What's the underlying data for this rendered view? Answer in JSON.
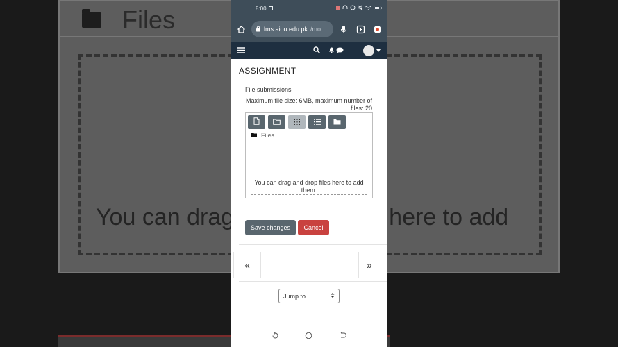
{
  "background": {
    "files_label": "Files",
    "drop_text": "You can drag and drop files here to add"
  },
  "status_bar": {
    "time": "8:00",
    "icons": [
      "notification-icon",
      "headphones-icon",
      "alarm-icon",
      "mute-icon",
      "wifi-icon",
      "battery-icon"
    ]
  },
  "browser": {
    "url_host": "lms.aiou.edu.pk",
    "url_path": "/mo"
  },
  "page": {
    "title": "ASSIGNMENT",
    "file_submissions_label": "File submissions",
    "max_info": "Maximum file size: 6MB, maximum number of files: 20",
    "filepicker": {
      "path_label": "Files",
      "drop_text": "You can drag and drop files here to add them."
    },
    "save_label": "Save changes",
    "cancel_label": "Cancel",
    "prev_symbol": "«",
    "next_symbol": "»",
    "jump_label": "Jump to..."
  },
  "colors": {
    "status_bar": "#3e4d59",
    "navbar": "#1e2f40",
    "button_secondary": "#59666e",
    "button_danger": "#c9423f"
  }
}
